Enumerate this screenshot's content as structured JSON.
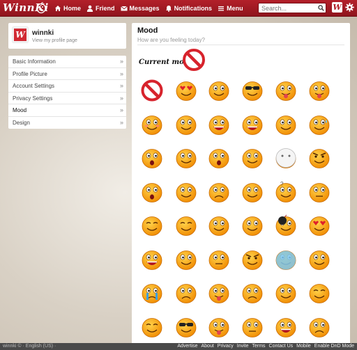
{
  "topbar": {
    "logo": "WinnKi",
    "nav": [
      {
        "label": "Home",
        "icon": "home-icon"
      },
      {
        "label": "Friend",
        "icon": "user-icon"
      },
      {
        "label": "Messages",
        "icon": "envelope-icon"
      },
      {
        "label": "Notifications",
        "icon": "bell-icon"
      },
      {
        "label": "Menu",
        "icon": "hamburger-icon"
      }
    ],
    "search_placeholder": "Search...",
    "brand_badge": "W",
    "accent_color": "#b3202a"
  },
  "profile": {
    "name": "winnki",
    "link": "View my profile page",
    "avatar_letter": "W"
  },
  "menu": {
    "items": [
      {
        "label": "Basic Information"
      },
      {
        "label": "Profile Picture"
      },
      {
        "label": "Account Settings"
      },
      {
        "label": "Privacy Settings"
      },
      {
        "label": "Mood"
      },
      {
        "label": "Design"
      }
    ],
    "selected": "Mood",
    "chevron": "»"
  },
  "main": {
    "title": "Mood",
    "subtitle": "How are you feeling today?",
    "current_mood_label": "Current mood:",
    "current_mood": "no-mood"
  },
  "moods": [
    [
      "no-mood",
      "in-love",
      "happy",
      "cool",
      "tongue-out",
      "tongue-out-wink"
    ],
    [
      "blushing",
      "smirk",
      "shouting",
      "laughing",
      "smug",
      "sweating"
    ],
    [
      "surprised",
      "bandaged",
      "worried",
      "covering",
      "ghost",
      "angry-mark"
    ],
    [
      "shocked",
      "smile",
      "sad",
      "grinning",
      "question",
      "neutral"
    ],
    [
      "sleeping",
      "squint",
      "bleeding",
      "bandaged-head",
      "bomb",
      "love-struck"
    ],
    [
      "big-grin",
      "fingers",
      "pouting",
      "furious",
      "freezing",
      "scolding"
    ],
    [
      "crying",
      "frowning",
      "drooling",
      "disappointed",
      "dizzy",
      "content"
    ],
    [
      "happy-eyes",
      "sunglasses",
      "tongue",
      "sly",
      "teeth",
      "hurt"
    ]
  ],
  "footer": {
    "left": "winnki © · English (US) ·",
    "links": [
      "Advertise",
      "About",
      "Privacy",
      "Invite",
      "Terms",
      "Contact Us",
      "Mobile",
      "Enable DnD Mode"
    ]
  }
}
